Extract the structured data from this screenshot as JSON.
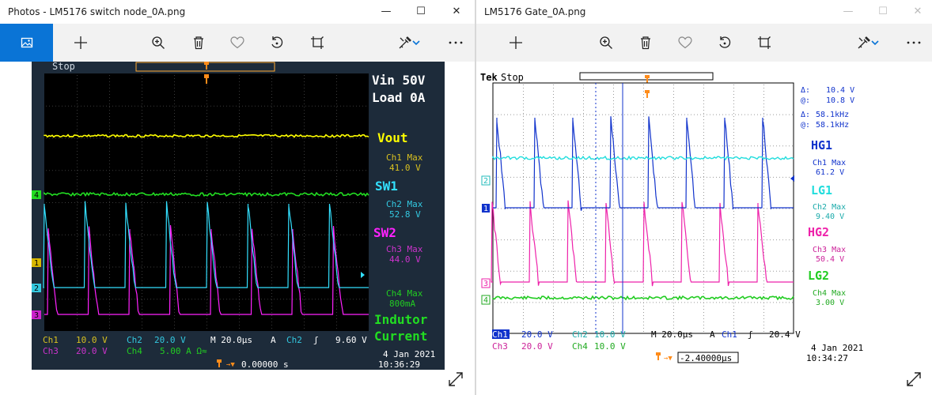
{
  "left_window": {
    "title": "Photos - LM5176 switch node_0A.png",
    "scope": {
      "status": "Stop",
      "header": [
        "Vin 50V",
        "Load 0A"
      ],
      "channels": [
        {
          "label": "Vout",
          "max_label": "Ch1 Max",
          "max_value": "41.0 V",
          "color": "#ffff00"
        },
        {
          "label": "SW1",
          "max_label": "Ch2 Max",
          "max_value": "52.8 V",
          "color": "#33e0ff"
        },
        {
          "label": "SW2",
          "max_label": "Ch3 Max",
          "max_value": "44.0 V",
          "color": "#ff22ff"
        },
        {
          "label": "Indutor Current",
          "max_label": "Ch4 Max",
          "max_value": "800mA",
          "color": "#22dd22"
        }
      ],
      "label4a": "Indutor",
      "label4b": "Current",
      "markers": [
        "1",
        "2",
        "3",
        "4"
      ],
      "scale": {
        "ch1": "Ch1",
        "ch1v": "10.0 V",
        "ch2": "Ch2",
        "ch2v": "20.0 V",
        "time": "M 20.0µs",
        "trig_a": "A",
        "trig_ch": "Ch2",
        "trig_sym": "ʃ",
        "trig_v": "9.60 V",
        "ch3": "Ch3",
        "ch3v": "20.0 V",
        "ch4": "Ch4",
        "ch4v": "5.00 A Ω≈"
      },
      "position": "0.00000 s",
      "date": "4 Jan  2021",
      "time_of_day": "10:36:29"
    }
  },
  "right_window": {
    "title": "LM5176 Gate_0A.png",
    "scope": {
      "brand": "Tek",
      "status": "Stop",
      "cursor": [
        {
          "k": "Δ:",
          "v": "10.4 V"
        },
        {
          "k": "@:",
          "v": "10.8 V"
        },
        {
          "k": "Δ:",
          "v": "58.1kHz"
        },
        {
          "k": "@:",
          "v": "58.1kHz"
        }
      ],
      "channels": [
        {
          "label": "HG1",
          "max_label": "Ch1 Max",
          "max_value": "61.2 V",
          "color": "#1133cc"
        },
        {
          "label": "LG1",
          "max_label": "Ch2 Max",
          "max_value": "9.40 V",
          "color": "#22dddd"
        },
        {
          "label": "HG2",
          "max_label": "Ch3 Max",
          "max_value": "50.4 V",
          "color": "#ee22aa"
        },
        {
          "label": "LG2",
          "max_label": "Ch4 Max",
          "max_value": "3.00 V",
          "color": "#22cc22"
        }
      ],
      "markers": [
        "2",
        "1",
        "3",
        "4"
      ],
      "scale": {
        "ch1": "Ch1",
        "ch1v": "20.0 V",
        "ch2": "Ch2",
        "ch2v": "10.0 V",
        "time": "M 20.0µs",
        "trig_a": "A",
        "trig_ch": "Ch1",
        "trig_sym": "ʃ",
        "trig_v": "20.4 V",
        "ch3": "Ch3",
        "ch3v": "20.0 V",
        "ch4": "Ch4",
        "ch4v": "10.0 V"
      },
      "position": "-2.40000µs",
      "date": "4 Jan  2021",
      "time_of_day": "10:34:27"
    }
  },
  "colors": {
    "accent": "#0a74d6",
    "scope_bg": "#1d2b3a"
  },
  "icons": [
    "image-icon",
    "plus-icon",
    "zoom-in-icon",
    "delete-icon",
    "heart-icon",
    "rotate-icon",
    "crop-icon",
    "edit-icon",
    "chevron-down-icon",
    "more-icon",
    "minimize-icon",
    "maximize-icon",
    "close-icon",
    "expand-icon"
  ]
}
